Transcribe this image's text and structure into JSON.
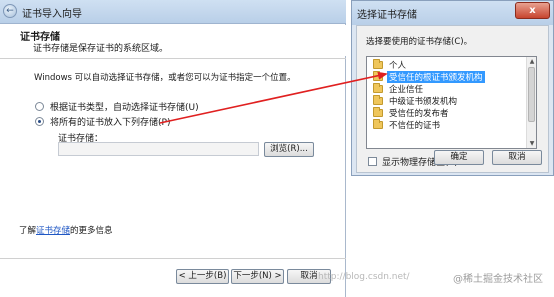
{
  "wizard": {
    "title": "证书导入向导",
    "header_title": "证书存储",
    "header_subtitle": "证书存储是保存证书的系统区域。",
    "intro": "Windows 可以自动选择证书存储，或者您可以为证书指定一个位置。",
    "radio_auto_label": "根据证书类型，自动选择证书存储(U)",
    "radio_manual_label": "将所有的证书放入下列存储(P)",
    "store_label": "证书存储：",
    "store_value": "",
    "browse_label": "浏览(R)...",
    "learn_more_prefix": "了解",
    "learn_more_link": "证书存储",
    "learn_more_suffix": "的更多信息",
    "back_label": "< 上一步(B)",
    "next_label": "下一步(N) >",
    "cancel_label": "取消"
  },
  "dialog": {
    "title": "选择证书存储",
    "close_glyph": "x",
    "prompt": "选择要使用的证书存储(C)。",
    "stores": [
      {
        "label": "个人",
        "selected": false
      },
      {
        "label": "受信任的根证书颁发机构",
        "selected": true
      },
      {
        "label": "企业信任",
        "selected": false
      },
      {
        "label": "中级证书颁发机构",
        "selected": false
      },
      {
        "label": "受信任的发布者",
        "selected": false
      },
      {
        "label": "不信任的证书",
        "selected": false
      }
    ],
    "show_physical_label": "显示物理存储区(S)",
    "show_physical_checked": false,
    "ok_label": "确定",
    "cancel_label": "取消"
  },
  "annotation": {
    "arrow_color": "#e02020"
  },
  "watermark": {
    "text": "http://blog.csdn.net/",
    "brand": "@稀土掘金技术社区"
  }
}
